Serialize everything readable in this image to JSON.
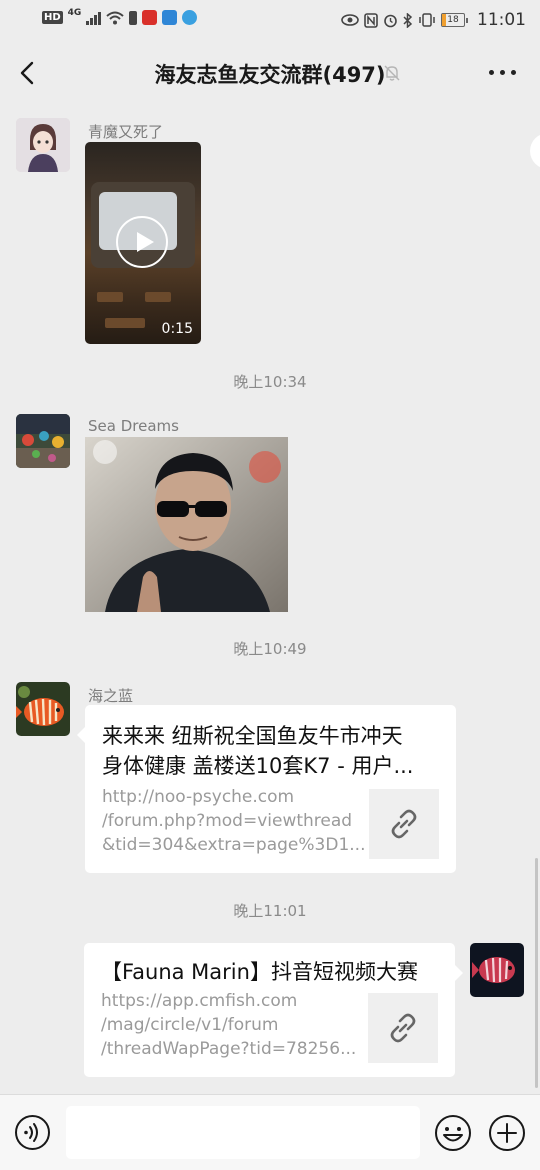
{
  "status_bar": {
    "hd_badge": "HD",
    "network": "4G",
    "battery_level": "18",
    "time": "11:01"
  },
  "header": {
    "title": "海友志鱼友交流群(497)"
  },
  "messages": [
    {
      "sender": "青魔又死了",
      "type": "video",
      "duration": "0:15"
    },
    {
      "type": "timestamp",
      "text": "晚上10:34"
    },
    {
      "sender": "Sea Dreams",
      "type": "image"
    },
    {
      "type": "timestamp",
      "text": "晚上10:49"
    },
    {
      "sender": "海之蓝",
      "type": "link",
      "title_line1": "来来来 纽斯祝全国鱼友牛市冲天",
      "title_line2": "身体健康 盖楼送10套K7 - 用户...",
      "url_line1": "http://noo-psyche.com",
      "url_line2": "/forum.php?mod=viewthread",
      "url_line3": "&tid=304&extra=page%3D1..."
    },
    {
      "type": "timestamp",
      "text": "晚上11:01"
    },
    {
      "sender": "me",
      "type": "link",
      "title_line1": "【Fauna Marin】抖音短视频大赛",
      "url_line1": "https://app.cmfish.com",
      "url_line2": "/mag/circle/v1/forum",
      "url_line3": "/threadWapPage?tid=78256..."
    }
  ],
  "input_bar": {
    "placeholder": ""
  },
  "colors": {
    "background": "#ededed",
    "bubble": "#ffffff",
    "timestamp_text": "#8a8a8a"
  }
}
